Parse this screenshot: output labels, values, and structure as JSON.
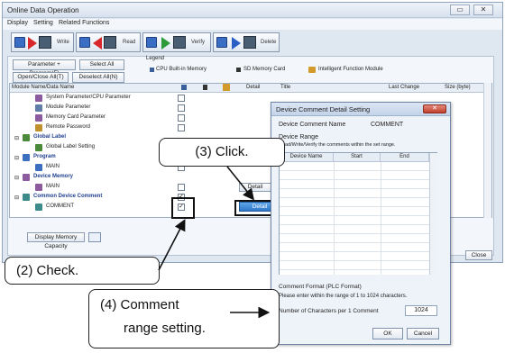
{
  "window": {
    "title": "Online Data Operation",
    "minimize": "▭",
    "close": "✕"
  },
  "menu": [
    "Display",
    "Setting",
    "Related Functions"
  ],
  "directions": [
    "Write",
    "Read",
    "Verify",
    "Delete"
  ],
  "panel": {
    "param_program_btn": "Parameter + Program(F)",
    "select_all_btn": "Select All",
    "open_close_btn": "Open/Close All(T)",
    "deselect_all_btn": "Deselect All(N)",
    "legend_title": "Legend",
    "legend_items": [
      "CPU Built-in Memory",
      "SD Memory Card",
      "Intelligent Function Module"
    ]
  },
  "table": {
    "headers": [
      "Module Name/Data Name",
      "Detail",
      "Title",
      "Last Change",
      "Size (byte)"
    ],
    "rows": [
      {
        "label": "System Parameter/CPU Parameter",
        "checked": ""
      },
      {
        "label": "Module Parameter",
        "checked": ""
      },
      {
        "label": "Memory Card Parameter",
        "checked": ""
      },
      {
        "label": "Remote Password",
        "checked": ""
      },
      {
        "label": "Global Label",
        "group": true
      },
      {
        "label": "Global Label Setting",
        "checked": ""
      },
      {
        "label": "Program",
        "group": true
      },
      {
        "label": "MAIN",
        "checked": ""
      },
      {
        "label": "Device Memory",
        "group": true
      },
      {
        "label": "MAIN",
        "checked": ""
      },
      {
        "label": "Common Device Comment",
        "group": true,
        "checked": "✓"
      },
      {
        "label": "COMMENT",
        "checked": "✓"
      }
    ],
    "detail_btn": "Detail"
  },
  "bottom": {
    "display_memory_btn": "Display Memory Capacity",
    "close_btn": "Close"
  },
  "dialog": {
    "title": "Device Comment Detail Setting",
    "close": "✕",
    "comment_name_label": "Device Comment Name",
    "comment_name_value": "COMMENT",
    "range_label": "Device Range",
    "range_hint": "Read/Write/Verify the comments within the set range.",
    "col_device": "Device Name",
    "col_start": "Start",
    "col_end": "End",
    "format_label": "Comment Format (PLC Format)",
    "format_hint": "Please enter within the range of 1 to 1024 characters.",
    "chars_label": "Number of Characters per 1 Comment",
    "chars_value": "1024",
    "ok": "OK",
    "cancel": "Cancel"
  },
  "callouts": {
    "step2": "(2) Check.",
    "step3": "(3) Click.",
    "step4_line1": "(4) Comment",
    "step4_line2": "range setting."
  }
}
